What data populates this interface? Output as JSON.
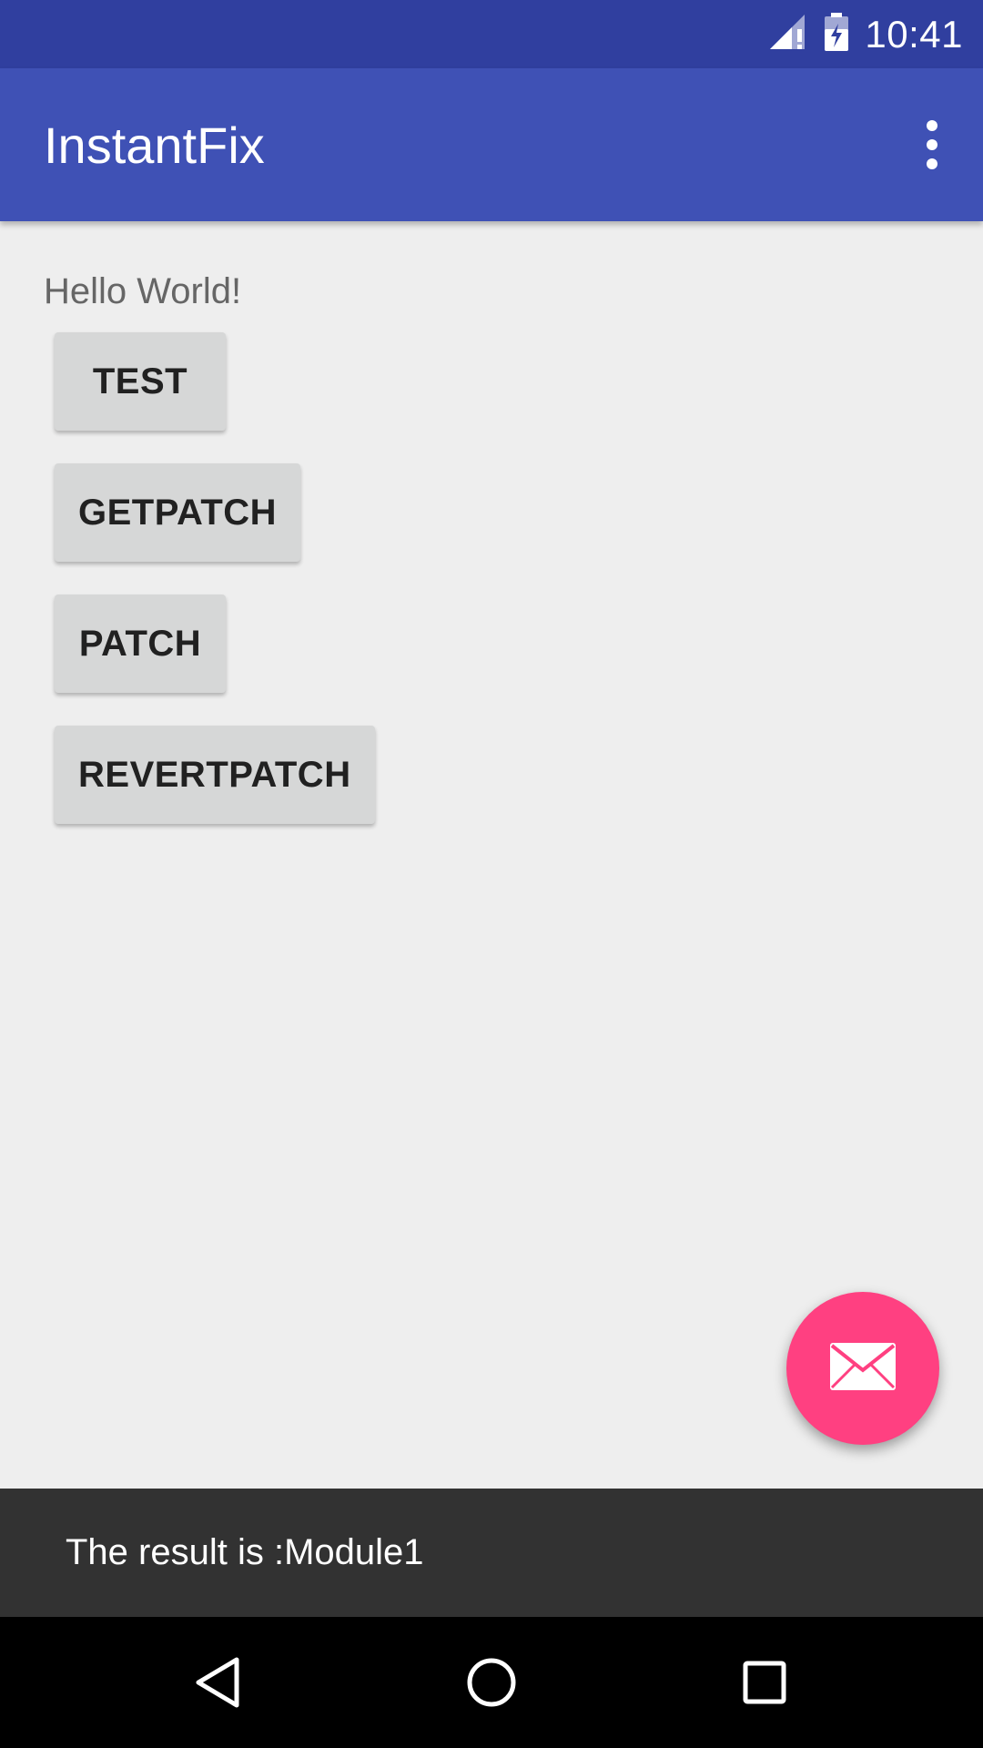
{
  "status_bar": {
    "time": "10:41",
    "icons": [
      "signal-icon",
      "battery-icon"
    ]
  },
  "app_bar": {
    "title": "InstantFix",
    "overflow_icon": "more-vert-icon"
  },
  "main": {
    "hello_text": "Hello World!",
    "buttons": [
      {
        "label": "TEST"
      },
      {
        "label": "GETPATCH"
      },
      {
        "label": "PATCH"
      },
      {
        "label": "REVERTPATCH"
      }
    ]
  },
  "fab": {
    "icon": "mail-icon",
    "color": "#ff4081"
  },
  "snackbar": {
    "text": "The result is :Module1"
  },
  "nav_bar": {
    "buttons": [
      "back-icon",
      "home-icon",
      "recents-icon"
    ]
  },
  "colors": {
    "primary": "#3f51b5",
    "primary_dark": "#303f9f",
    "accent": "#ff4081"
  }
}
